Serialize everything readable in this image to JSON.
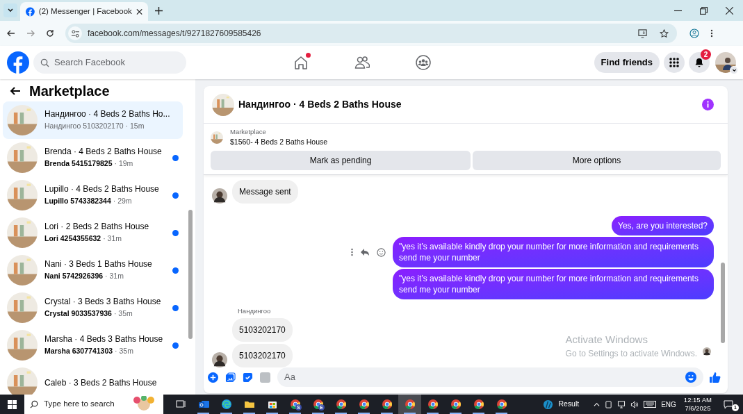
{
  "browser": {
    "tab_title": "(2) Messenger | Facebook",
    "url": "facebook.com/messages/t/9271827609585426"
  },
  "header": {
    "search_placeholder": "Search Facebook",
    "home_notification": true,
    "find_friends": "Find friends",
    "notification_count": "2"
  },
  "sidebar": {
    "title": "Marketplace",
    "conversations": [
      {
        "title": "Нандингоо · 4 Beds 2 Baths Ho...",
        "preview": "Нандингоо 5103202170",
        "time": "· 15m",
        "selected": true,
        "unread": false
      },
      {
        "title": "Brenda · 4 Beds 2 Baths House",
        "preview": "Brenda 5415179825",
        "time": "· 19m",
        "selected": false,
        "unread": true
      },
      {
        "title": "Lupillo · 4 Beds 2 Baths House",
        "preview": "Lupillo 5743382344",
        "time": "· 29m",
        "selected": false,
        "unread": true
      },
      {
        "title": "Lori · 2 Beds 2 Baths House",
        "preview": "Lori 4254355632",
        "time": "· 31m",
        "selected": false,
        "unread": true
      },
      {
        "title": "Nani · 3 Beds 1 Baths House",
        "preview": "Nani 5742926396",
        "time": "· 31m",
        "selected": false,
        "unread": true
      },
      {
        "title": "Crystal · 3 Beds 3 Baths House",
        "preview": "Crystal 9033537936",
        "time": "· 35m",
        "selected": false,
        "unread": true
      },
      {
        "title": "Marsha · 4 Beds 3 Baths House",
        "preview": "Marsha 6307741303",
        "time": "· 35m",
        "selected": false,
        "unread": true
      },
      {
        "title": "Caleb · 3 Beds 2 Baths House",
        "selected": false
      }
    ]
  },
  "chat": {
    "title": "Нандингоо · 4 Beds 2 Baths House",
    "listing": {
      "label": "Marketplace",
      "name": "$1560- 4 Beds 2 Baths House"
    },
    "actions": [
      "Mark as pending",
      "More options"
    ],
    "messages": [
      {
        "kind": "received",
        "text": "Message sent",
        "avatar": true
      },
      {
        "kind": "sent",
        "text": "Yes, are you interested?",
        "tools": false
      },
      {
        "kind": "sent",
        "text": "\"yes it’s available kindly drop your number for more information and requirements send me your number",
        "tools": true
      },
      {
        "kind": "sent",
        "text": "\"yes it’s available kindly drop your number for more information and requirements send me your number",
        "tools": false
      },
      {
        "kind": "sender",
        "text": "Нандингоо"
      },
      {
        "kind": "received",
        "text": "5103202170",
        "avatar": false
      },
      {
        "kind": "received",
        "text": "5103202170",
        "avatar": true
      }
    ],
    "composer_placeholder": "Aa"
  },
  "activation_notice": {
    "title": "Activate Windows",
    "subtitle": "Go to Settings to activate Windows."
  },
  "taskbar": {
    "search_placeholder": "Type here to search",
    "apps": [
      {
        "kind": "taskview",
        "selected": false
      },
      {
        "kind": "outlook",
        "selected": false
      },
      {
        "kind": "edge",
        "selected": false
      },
      {
        "kind": "folder",
        "selected": false
      },
      {
        "kind": "store",
        "selected": false
      },
      {
        "kind": "chrome",
        "badge": "S",
        "selected": false
      },
      {
        "kind": "chrome",
        "badge": "E",
        "selected": false
      },
      {
        "kind": "chrome",
        "selected": false
      },
      {
        "kind": "chrome",
        "selected": false
      },
      {
        "kind": "chrome",
        "selected": false
      },
      {
        "kind": "chrome",
        "selected": true
      },
      {
        "kind": "chrome",
        "selected": false
      },
      {
        "kind": "chrome",
        "selected": false
      },
      {
        "kind": "chrome",
        "selected": false
      },
      {
        "kind": "chrome",
        "selected": false
      }
    ],
    "weather": "Result",
    "language": "ENG",
    "time": "12:15 AM",
    "date": "7/6/2025",
    "notifications": "1"
  }
}
